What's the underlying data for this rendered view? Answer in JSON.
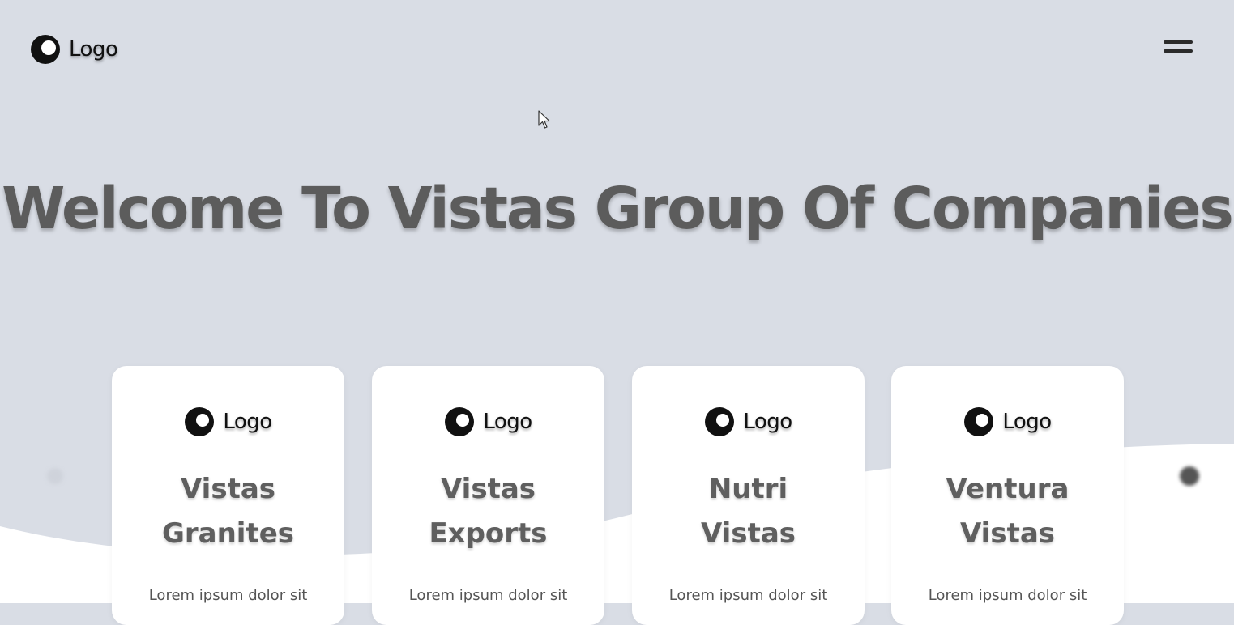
{
  "header": {
    "logo_text": "Logo"
  },
  "hero": {
    "title": "Welcome To Vistas Group Of Companies"
  },
  "cards": [
    {
      "logo_text": "Logo",
      "title_line1": "Vistas",
      "title_line2": "Granites",
      "text": "Lorem ipsum dolor sit"
    },
    {
      "logo_text": "Logo",
      "title_line1": "Vistas",
      "title_line2": "Exports",
      "text": "Lorem ipsum dolor sit"
    },
    {
      "logo_text": "Logo",
      "title_line1": "Nutri",
      "title_line2": "Vistas",
      "text": "Lorem ipsum dolor sit"
    },
    {
      "logo_text": "Logo",
      "title_line1": "Ventura",
      "title_line2": "Vistas",
      "text": "Lorem ipsum dolor sit"
    }
  ],
  "icons": {
    "logo": "logo-icon",
    "menu": "hamburger-menu-icon",
    "cursor": "mouse-cursor-icon"
  },
  "colors": {
    "background": "#d9dde5",
    "card": "#ffffff",
    "title": "#5c5c5c"
  }
}
